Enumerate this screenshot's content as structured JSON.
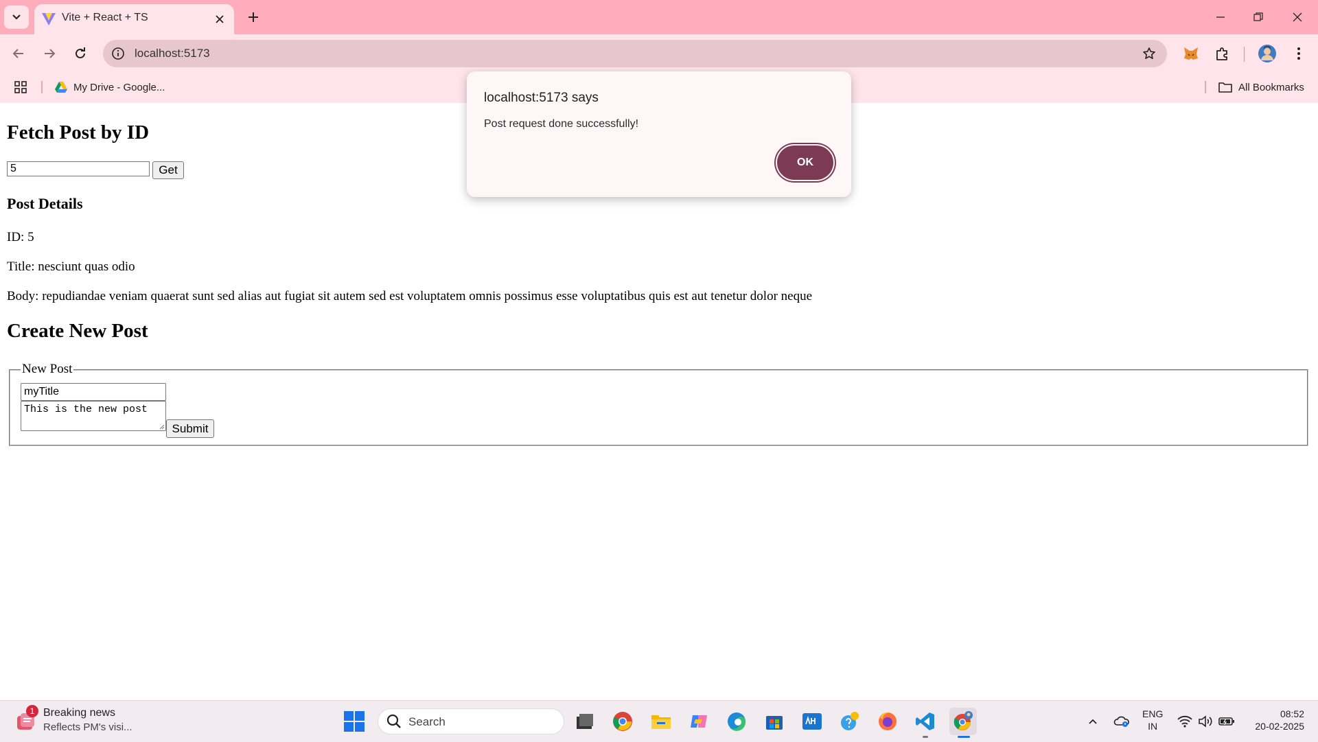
{
  "browser": {
    "tab_title": "Vite + React + TS",
    "url": "localhost:5173",
    "bookmarks": [
      {
        "label": "My Drive - Google..."
      }
    ],
    "all_bookmarks_label": "All Bookmarks"
  },
  "page": {
    "fetch_heading": "Fetch Post by ID",
    "id_input_value": "5",
    "get_button_label": "Get",
    "details_heading": "Post Details",
    "id_line": "ID: 5",
    "title_line": "Title: nesciunt quas odio",
    "body_line": "Body: repudiandae veniam quaerat sunt sed alias aut fugiat sit autem sed est voluptatem omnis possimus esse voluptatibus quis est aut tenetur dolor neque",
    "create_heading": "Create New Post",
    "legend": "New Post",
    "title_input_value": "myTitle",
    "body_textarea_value": "This is the new post",
    "submit_label": "Submit"
  },
  "dialog": {
    "title": "localhost:5173 says",
    "message": "Post request done successfully!",
    "ok_label": "OK"
  },
  "taskbar": {
    "news_badge": "1",
    "news_title": "Breaking news",
    "news_subtitle": "Reflects PM's visi...",
    "search_placeholder": "Search",
    "lang_line1": "ENG",
    "lang_line2": "IN",
    "time": "08:52",
    "date": "20-02-2025"
  },
  "colors": {
    "titlebar": "#ffadbd",
    "toolbar": "#ffe4ec",
    "dialog_ok": "#7c3b52"
  }
}
